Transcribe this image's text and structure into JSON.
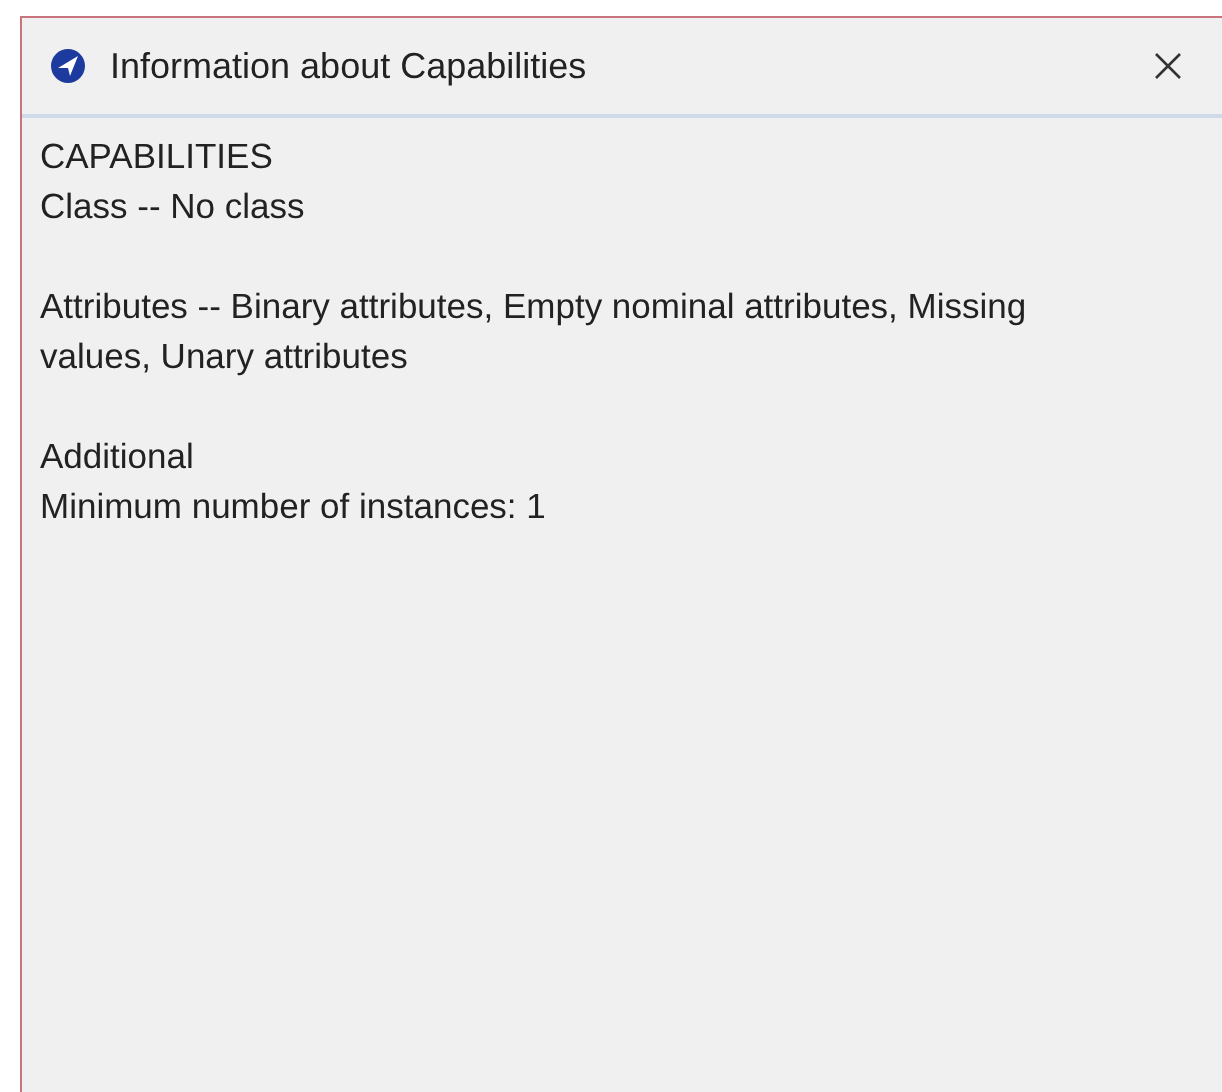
{
  "window": {
    "title": "Information about Capabilities"
  },
  "paragraphs": [
    [
      "CAPABILITIES",
      "Class -- No class"
    ],
    [
      "Attributes -- Binary attributes, Empty nominal attributes, Missing values, Unary attributes"
    ],
    [
      "Additional",
      "Minimum number of instances: 1"
    ]
  ]
}
